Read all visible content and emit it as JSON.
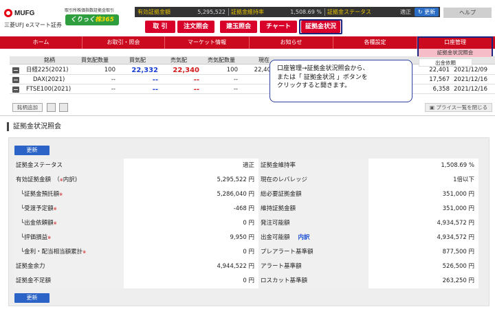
{
  "header": {
    "brand": "MUFG",
    "brand_sub": "三菱UFJ eスマート証券",
    "kurikku_caption": "取引所株価指数証拠金取引",
    "kurikku_logo_a": "くりっく",
    "kurikku_logo_b": "株365",
    "status": {
      "yuko_label": "有効証拠金額",
      "yuko_value": "5,295,522",
      "iji_label": "証拠金維持率",
      "iji_value": "1,508.69 %",
      "status_label": "証拠金ステータス",
      "status_value": "適正"
    },
    "refresh_label": "更新",
    "help_label": "ヘルプ",
    "buttons": [
      "取 引",
      "注文照会",
      "建玉照会",
      "チャート",
      "証拠金状況"
    ]
  },
  "nav": {
    "items": [
      "ホーム",
      "お取引・照会",
      "マーケット情報",
      "お知らせ",
      "各種設定",
      "口座管理"
    ],
    "submenu": [
      "証拠金状況照会",
      "出金依頼"
    ]
  },
  "quotes": {
    "headers": [
      "銘柄",
      "買気配数量",
      "買気配",
      "売気配",
      "売気配数量",
      "現在"
    ],
    "rows": [
      {
        "name": "日経225(2021)",
        "bid_qty": "100",
        "bid": "22,332",
        "ask": "22,340",
        "ask_qty": "100",
        "now": "22,40",
        "last": "22,401",
        "date": "2021/12/09"
      },
      {
        "name": "DAX(2021)",
        "bid_qty": "--",
        "bid": "--",
        "ask": "--",
        "ask_qty": "--",
        "now": "",
        "last": "17,567",
        "date": "2021/12/16"
      },
      {
        "name": "FTSE100(2021)",
        "bid_qty": "--",
        "bid": "--",
        "ask": "--",
        "ask_qty": "--",
        "now": "",
        "last": "6,358",
        "date": "2021/12/16"
      }
    ],
    "add_label": "銘柄追加",
    "close_label": "プライス一覧を閉じる"
  },
  "callout": {
    "line1": "口座管理→証拠金状況照会から、",
    "line2": "または「 証拠金状況 」ボタンを",
    "line3": "クリックすると開きます。"
  },
  "page": {
    "title": "証拠金状況照会",
    "update_label": "更新"
  },
  "margin_table": {
    "note_mark": "※",
    "naiwake": "内訳",
    "left": [
      {
        "label": "証拠金ステータス",
        "value": "適正"
      },
      {
        "label": "有効証拠金額　（",
        "label_suffix": "内訳)",
        "value": "5,295,522 円"
      },
      {
        "label": "└証拠金預託額",
        "value": "5,286,040 円"
      },
      {
        "label": "└受渡予定額",
        "value": "-468 円"
      },
      {
        "label": "└出金依頼額",
        "value": "0 円"
      },
      {
        "label": "└評価損益",
        "value": "9,950 円"
      },
      {
        "label": "└金利・配当相当額累計",
        "value": "0 円"
      },
      {
        "label": "証拠金余力",
        "value": "4,944,522 円"
      },
      {
        "label": "証拠金不足額",
        "value": "0 円"
      }
    ],
    "right": [
      {
        "label": "証拠金維持率",
        "value": "1,508.69 %"
      },
      {
        "label": "現在のレバレッジ",
        "value": "1倍以下"
      },
      {
        "label": "総必要証拠金額",
        "value": "351,000 円"
      },
      {
        "label": "維持証拠金額",
        "value": "351,000 円"
      },
      {
        "label": "発注可能額",
        "value": "4,934,572 円"
      },
      {
        "label": "出金可能額",
        "value": "4,934,572 円"
      },
      {
        "label": "プレアラート基準額",
        "value": "877,500 円"
      },
      {
        "label": "アラート基準額",
        "value": "526,500 円"
      },
      {
        "label": "ロスカット基準額",
        "value": "263,250 円"
      }
    ]
  },
  "colors": {
    "accent_red": "#cc0a1f",
    "button_red": "#d8002a",
    "update_blue": "#2b63c6",
    "bid_blue": "#1a3fd4",
    "ask_red": "#d21a1a",
    "highlight_navy": "#1a237e"
  }
}
